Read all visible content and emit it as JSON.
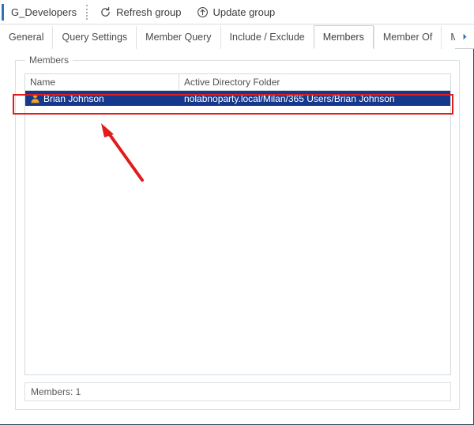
{
  "command_bar": {
    "group_name": "G_Developers",
    "buttons": [
      {
        "label": "Refresh group",
        "icon": "refresh-icon"
      },
      {
        "label": "Update group",
        "icon": "update-circle-up-icon"
      }
    ]
  },
  "tabs": [
    {
      "label": "General",
      "active": false
    },
    {
      "label": "Query Settings",
      "active": false
    },
    {
      "label": "Member Query",
      "active": false
    },
    {
      "label": "Include / Exclude",
      "active": false
    },
    {
      "label": "Members",
      "active": true
    },
    {
      "label": "Member Of",
      "active": false
    },
    {
      "label": "Manage",
      "active": false,
      "truncated": true
    }
  ],
  "tab_overflow": {
    "icon": "chevron-right-icon"
  },
  "members_panel": {
    "groupbox_label": "Members",
    "columns": [
      {
        "key": "name",
        "label": "Name"
      },
      {
        "key": "folder",
        "label": "Active Directory Folder"
      }
    ],
    "rows": [
      {
        "name": "Brian Johnson",
        "folder": "nolabnoparty.local/Milan/365  Users/Brian  Johnson",
        "icon": "user-icon",
        "selected": true
      }
    ],
    "status_text": "Members: 1"
  },
  "colors": {
    "selection_background": "#16388c",
    "accent_blue": "#2f72b8",
    "annotation_red": "#e21b1b",
    "user_icon_gold": "#f0a626"
  }
}
